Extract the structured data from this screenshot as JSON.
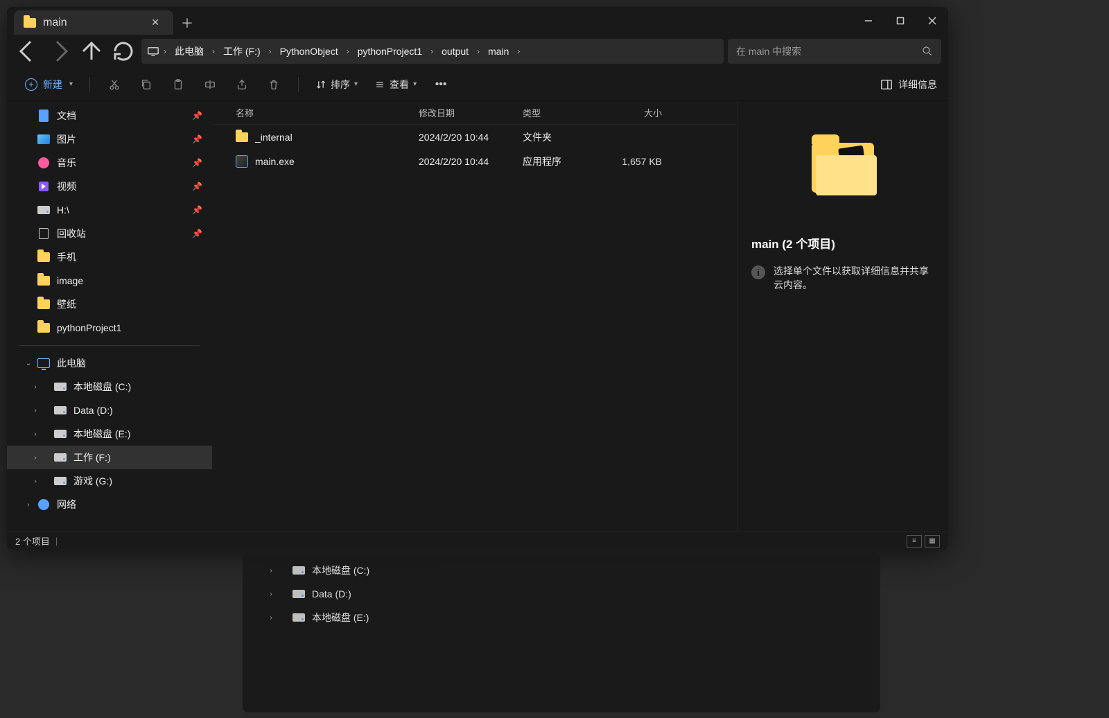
{
  "window": {
    "tab_title": "main",
    "search_placeholder": "在 main 中搜索"
  },
  "breadcrumb": [
    "此电脑",
    "工作 (F:)",
    "PythonObject",
    "pythonProject1",
    "output",
    "main"
  ],
  "toolbar": {
    "new_label": "新建",
    "sort_label": "排序",
    "view_label": "查看",
    "details_label": "详细信息"
  },
  "sidebar_quick": [
    {
      "label": "文档",
      "icon": "doc",
      "pinned": true
    },
    {
      "label": "图片",
      "icon": "pic",
      "pinned": true
    },
    {
      "label": "音乐",
      "icon": "music",
      "pinned": true
    },
    {
      "label": "视频",
      "icon": "video",
      "pinned": true
    },
    {
      "label": "H:\\",
      "icon": "disk",
      "pinned": true
    },
    {
      "label": "回收站",
      "icon": "recycle",
      "pinned": true
    },
    {
      "label": "手机",
      "icon": "folder",
      "pinned": false
    },
    {
      "label": "image",
      "icon": "folder",
      "pinned": false
    },
    {
      "label": "壁纸",
      "icon": "folder",
      "pinned": false
    },
    {
      "label": "pythonProject1",
      "icon": "folder",
      "pinned": false
    }
  ],
  "sidebar_pc": {
    "label": "此电脑"
  },
  "sidebar_drives": [
    {
      "label": "本地磁盘 (C:)"
    },
    {
      "label": "Data (D:)"
    },
    {
      "label": "本地磁盘 (E:)"
    },
    {
      "label": "工作 (F:)",
      "selected": true
    },
    {
      "label": "游戏 (G:)"
    }
  ],
  "sidebar_network": {
    "label": "网络"
  },
  "columns": {
    "name": "名称",
    "date": "修改日期",
    "type": "类型",
    "size": "大小"
  },
  "rows": [
    {
      "name": "_internal",
      "date": "2024/2/20 10:44",
      "type": "文件夹",
      "size": "",
      "icon": "folder"
    },
    {
      "name": "main.exe",
      "date": "2024/2/20 10:44",
      "type": "应用程序",
      "size": "1,657 KB",
      "icon": "exe"
    }
  ],
  "details": {
    "title": "main (2 个项目)",
    "hint": "选择单个文件以获取详细信息并共享云内容。"
  },
  "status": {
    "text": "2 个项目"
  },
  "lower_drives": [
    {
      "label": "本地磁盘 (C:)"
    },
    {
      "label": "Data (D:)"
    },
    {
      "label": "本地磁盘 (E:)"
    }
  ]
}
